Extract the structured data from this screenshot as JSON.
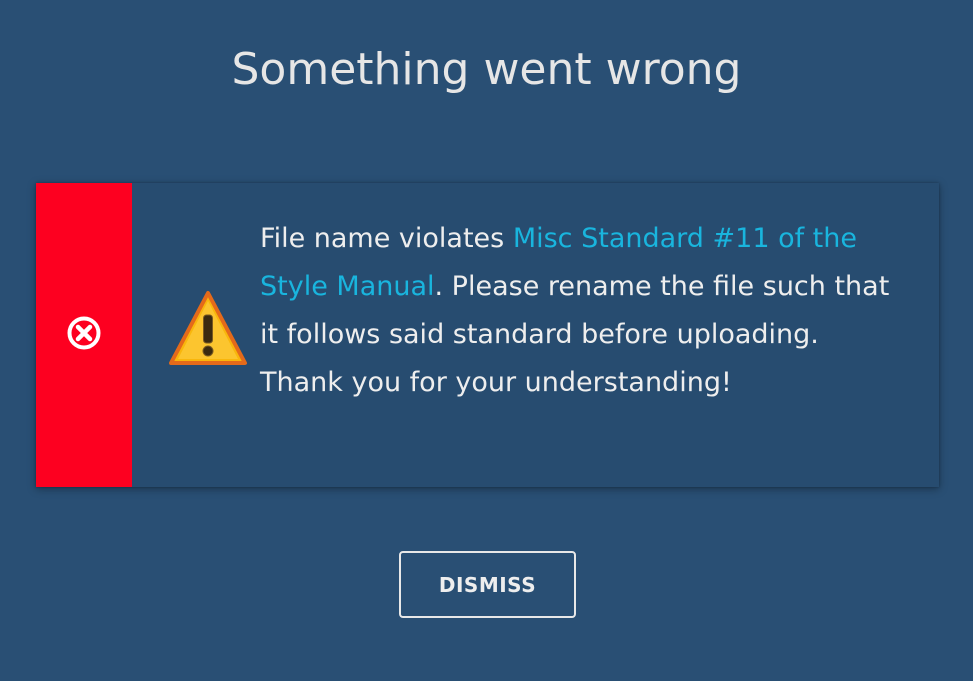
{
  "dialog": {
    "title": "Something went wrong",
    "message": {
      "prefix": "File name violates ",
      "link_text": "Misc Standard #11 of the Style Manual",
      "suffix": ". Please rename the file such that it follows said standard before uploading. Thank you for your understanding!"
    },
    "icons": {
      "status": "error-circle-x-icon",
      "alert": "warning-triangle-icon"
    },
    "dismiss_label": "DISMISS"
  },
  "colors": {
    "background": "#294f74",
    "error_stripe": "#fd0020",
    "link": "#19b5de",
    "text": "#eeeeee",
    "warning_fill": "#f9b60c",
    "warning_border": "#e46a1a"
  }
}
